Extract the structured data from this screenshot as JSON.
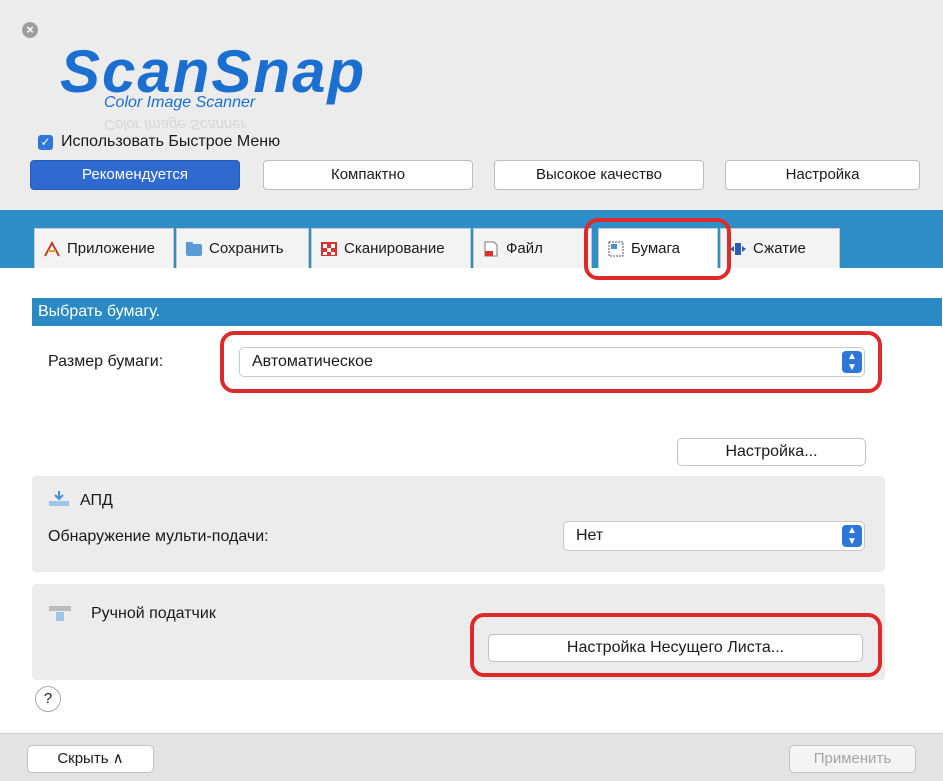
{
  "window": {
    "close_glyph": "×"
  },
  "logo": {
    "main": "ScanSnap",
    "sub": "Color Image Scanner"
  },
  "quick_menu": {
    "checked": true,
    "label": "Использовать Быстрое Меню"
  },
  "presets": [
    "Рекомендуется",
    "Компактно",
    "Высокое качество",
    "Настройка"
  ],
  "tabs": [
    "Приложение",
    "Сохранить",
    "Сканирование",
    "Файл",
    "Бумага",
    "Сжатие"
  ],
  "selected_tab": "Бумага",
  "paper": {
    "section_title": "Выбрать бумагу.",
    "size_label": "Размер бумаги:",
    "size_value": "Автоматическое",
    "settings_button": "Настройка..."
  },
  "adf": {
    "title": "АПД",
    "multifeed_label": "Обнаружение мульти-подачи:",
    "multifeed_value": "Нет"
  },
  "manual": {
    "title": "Ручной податчик",
    "carrier_button": "Настройка Несущего Листа..."
  },
  "help": {
    "glyph": "?"
  },
  "footer": {
    "hide_label": "Скрыть ∧",
    "apply_label": "Применить"
  },
  "colors": {
    "accent": "#2f6ad0",
    "tabbar": "#2d8ec8",
    "highlight": "#dd2a2a"
  }
}
